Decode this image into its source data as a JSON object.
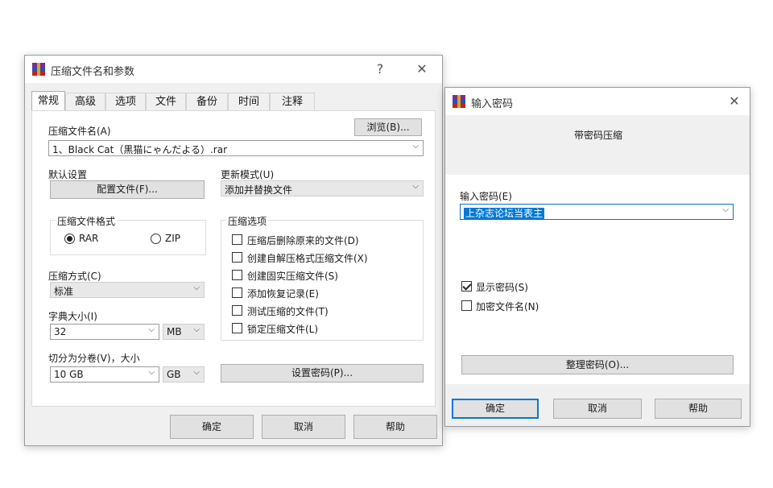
{
  "archive_dialog": {
    "title": "压缩文件名和参数",
    "help_glyph": "?",
    "close_glyph": "✕",
    "tabs": [
      "常规",
      "高级",
      "选项",
      "文件",
      "备份",
      "时间",
      "注释"
    ],
    "active_tab": "常规",
    "archive_name_label": "压缩文件名(A)",
    "browse_button": "浏览(B)...",
    "archive_name_value": "1、Black Cat（黒猫にゃんだよる）.rar",
    "default_settings_label": "默认设置",
    "profiles_button": "配置文件(F)...",
    "update_mode_label": "更新模式(U)",
    "update_mode_value": "添加并替换文件",
    "format_group": {
      "legend": "压缩文件格式",
      "options": [
        "RAR",
        "ZIP"
      ],
      "selected": "RAR"
    },
    "compression_method_label": "压缩方式(C)",
    "compression_method_value": "标准",
    "dictionary_size_label": "字典大小(I)",
    "dictionary_size_value": "32",
    "dictionary_unit_value": "MB",
    "split_label": "切分为分卷(V)，大小",
    "split_size_value": "10 GB",
    "split_unit_value": "GB",
    "options_group": {
      "legend": "压缩选项",
      "items": [
        {
          "label": "压缩后删除原来的文件(D)",
          "checked": false
        },
        {
          "label": "创建自解压格式压缩文件(X)",
          "checked": false
        },
        {
          "label": "创建固实压缩文件(S)",
          "checked": false
        },
        {
          "label": "添加恢复记录(E)",
          "checked": false
        },
        {
          "label": "测试压缩的文件(T)",
          "checked": false
        },
        {
          "label": "锁定压缩文件(L)",
          "checked": false
        }
      ]
    },
    "set_password_button": "设置密码(P)...",
    "ok_button": "确定",
    "cancel_button": "取消",
    "help_button": "帮助"
  },
  "password_dialog": {
    "title": "输入密码",
    "close_glyph": "✕",
    "subtitle": "带密码压缩",
    "password_label": "输入密码(E)",
    "password_value": "上杂志论坛当表主",
    "show_password_label": "显示密码(S)",
    "show_password_checked": true,
    "encrypt_names_label": "加密文件名(N)",
    "encrypt_names_checked": false,
    "organize_button": "整理密码(O)...",
    "ok_button": "确定",
    "cancel_button": "取消",
    "help_button": "帮助"
  },
  "colors": {
    "accent": "#0078d7",
    "window_bg": "#f0f0f0",
    "panel_bg": "#ffffff"
  }
}
